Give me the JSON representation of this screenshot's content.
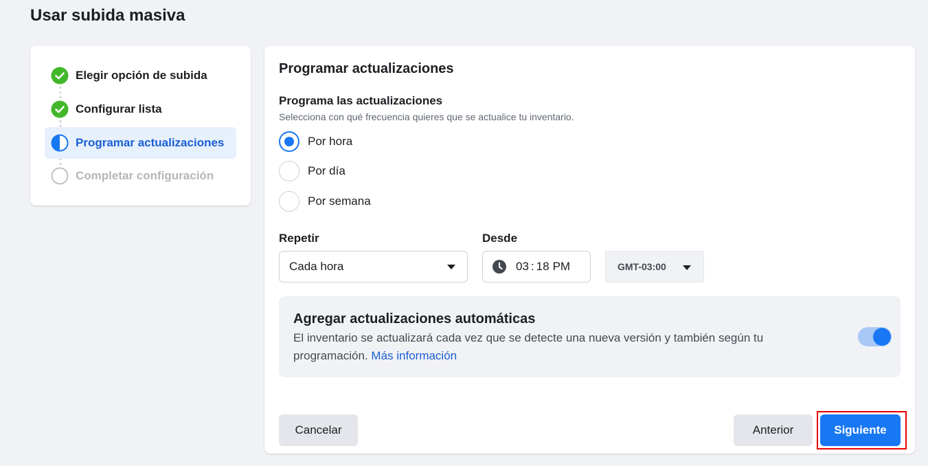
{
  "page": {
    "title": "Usar subida masiva"
  },
  "steps": [
    {
      "label": "Elegir opción de subida",
      "status": "done"
    },
    {
      "label": "Configurar lista",
      "status": "done"
    },
    {
      "label": "Programar actualizaciones",
      "status": "current"
    },
    {
      "label": "Completar configuración",
      "status": "todo"
    }
  ],
  "schedule": {
    "card_title": "Programar actualizaciones",
    "section_title": "Programa las actualizaciones",
    "section_subtitle": "Selecciona con qué frecuencia quieres que se actualice tu inventario.",
    "frequency_options": [
      {
        "label": "Por hora",
        "selected": true
      },
      {
        "label": "Por día",
        "selected": false
      },
      {
        "label": "Por semana",
        "selected": false
      }
    ],
    "repeat": {
      "label": "Repetir",
      "value": "Cada hora"
    },
    "from": {
      "label": "Desde",
      "hour": "03",
      "minute": "18",
      "period": "PM"
    },
    "timezone": {
      "value": "GMT-03:00"
    }
  },
  "auto_updates": {
    "title": "Agregar actualizaciones automáticas",
    "description": "El inventario se actualizará cada vez que se detecte una nueva versión y también según tu programación.",
    "link": "Más información",
    "enabled": true
  },
  "footer": {
    "cancel_label": "Cancelar",
    "back_label": "Anterior",
    "next_label": "Siguiente"
  },
  "colors": {
    "primary": "#1877f2",
    "success": "#42b72a",
    "highlight": "#e60000"
  },
  "icons": {
    "step_done": "check-circle-icon",
    "step_current": "half-circle-icon",
    "step_todo": "empty-circle-icon",
    "time": "clock-icon",
    "dropdown": "caret-down-icon"
  }
}
